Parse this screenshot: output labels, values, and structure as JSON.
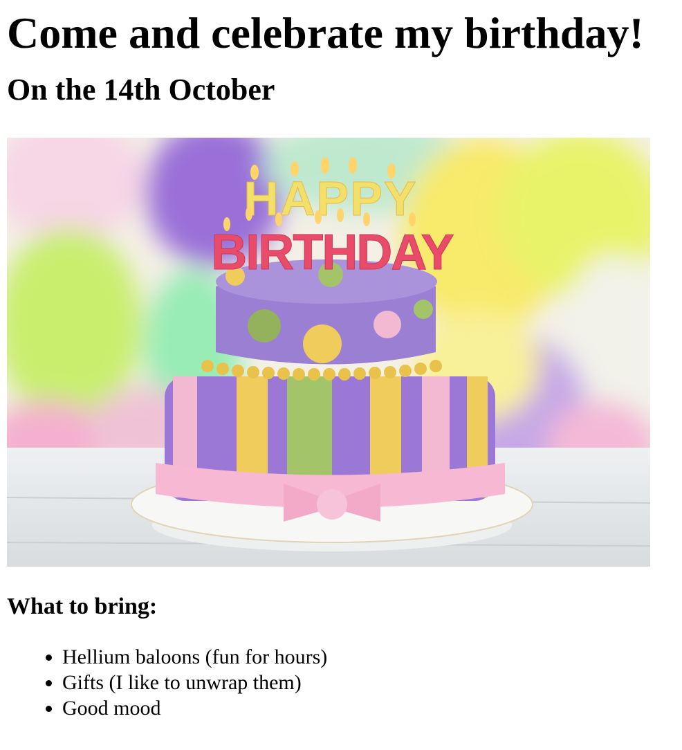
{
  "header": {
    "title": "Come and celebrate my birthday!",
    "date": "On the 14th October"
  },
  "image": {
    "icon": "birthday-cake-photo",
    "candles_line1": "HAPPY",
    "candles_line2": "BIRTHDAY"
  },
  "bring": {
    "heading": "What to bring:",
    "items": [
      "Hellium baloons (fun for hours)",
      "Gifts (I like to unwrap them)",
      "Good mood"
    ]
  }
}
